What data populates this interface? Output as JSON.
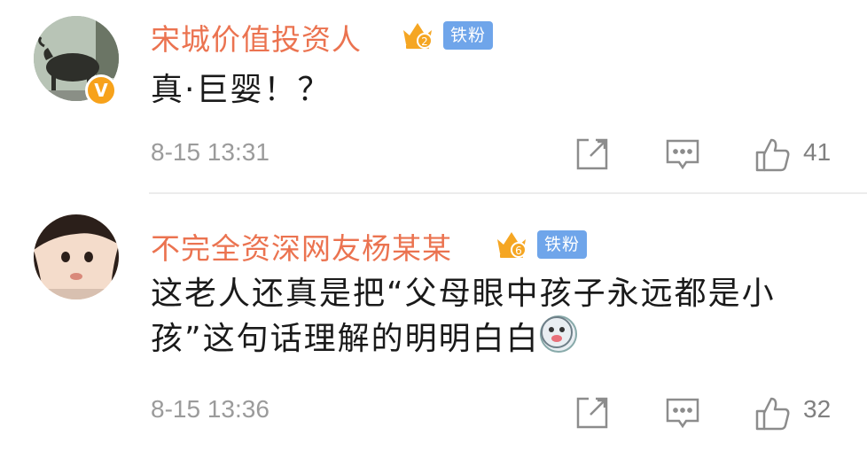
{
  "comments": [
    {
      "username": "宋城价值投资人",
      "crown_level": "2",
      "badge": "铁粉",
      "verified_mark": "V",
      "text": "真·巨婴！？",
      "time": "8-15 13:31",
      "likes": "41",
      "icons": {
        "repost": "share-icon",
        "reply": "comment-icon",
        "like": "thumbs-up-icon",
        "crown": "crown-icon"
      }
    },
    {
      "username": "不完全资深网友杨某某",
      "crown_level": "6",
      "badge": "铁粉",
      "text": "这老人还真是把“父母眼中孩子永远都是小孩”这句话理解的明明白白",
      "emoji": "husky-emoji-icon",
      "time": "8-15 13:36",
      "likes": "32",
      "icons": {
        "repost": "share-icon",
        "reply": "comment-icon",
        "like": "thumbs-up-icon",
        "crown": "crown-icon"
      }
    }
  ],
  "colors": {
    "username": "#eb7350",
    "badge": "#6fa5ea",
    "crown": "#f5a623",
    "text": "#1a1a1a",
    "meta": "#9b9b9b"
  }
}
